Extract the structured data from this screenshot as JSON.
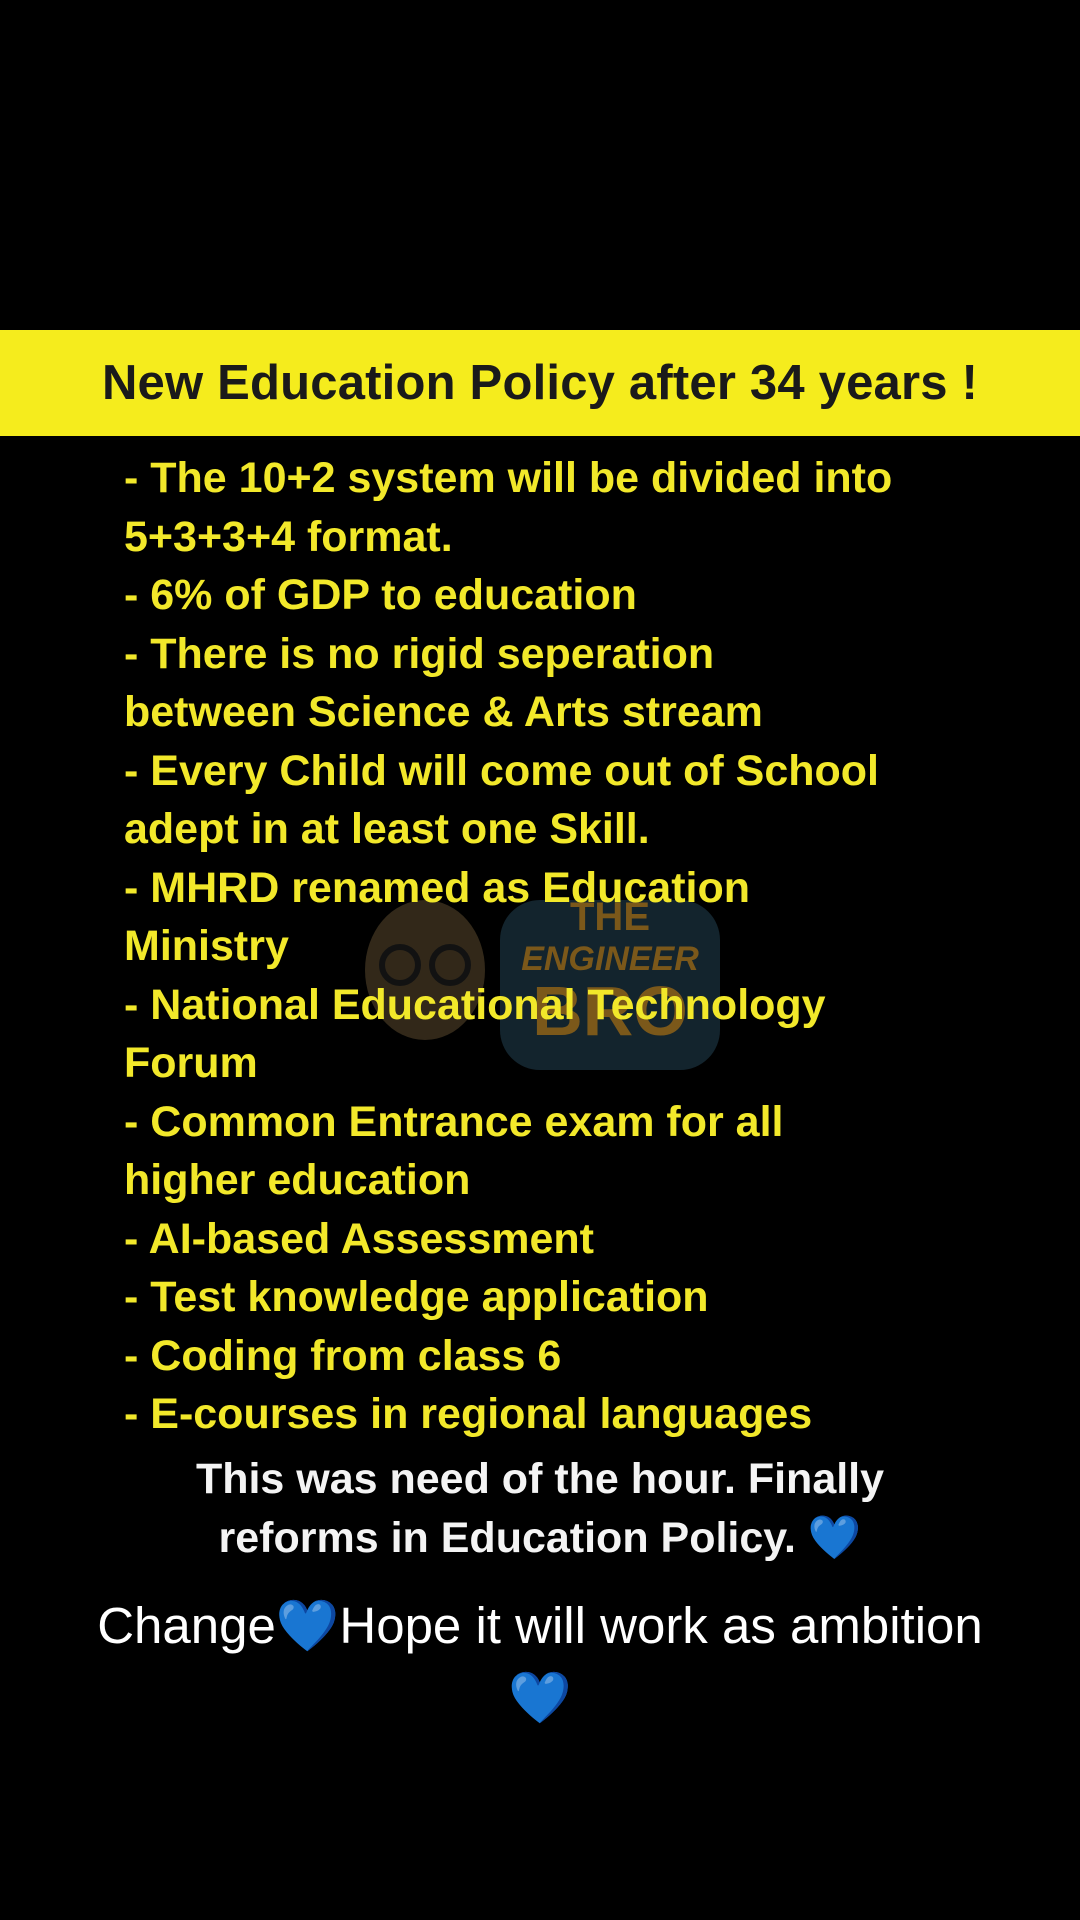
{
  "banner": {
    "title": "New Education Policy after 34 years !",
    "background_color": "#f5ec1d"
  },
  "policy_points": [
    "- The 10+2 system will be divided into",
    "5+3+3+4 format.",
    "- 6% of GDP to education",
    "- There is no rigid seperation",
    "between Science & Arts stream",
    "- Every Child will come out of School",
    "adept in at least one Skill.",
    "- MHRD renamed as Education",
    "Ministry",
    "- National Educational Technology",
    "Forum",
    "- Common Entrance exam for all",
    "higher education",
    "- AI-based Assessment",
    "- Test knowledge application",
    "- Coding from class 6",
    "- E-courses in regional languages"
  ],
  "closing": {
    "line1": "This was need of the hour. Finally",
    "line2": "reforms in Education Policy. 💙"
  },
  "caption": {
    "line1": "Change💙Hope it will work as ambition",
    "line2": "💙"
  },
  "watermark": {
    "text_top": "THE",
    "text_mid": "ENGINEER",
    "text_bottom": "BRO"
  },
  "colors": {
    "text_yellow": "#f2e82a",
    "background": "#000000",
    "heart": "#3a9ae0"
  }
}
